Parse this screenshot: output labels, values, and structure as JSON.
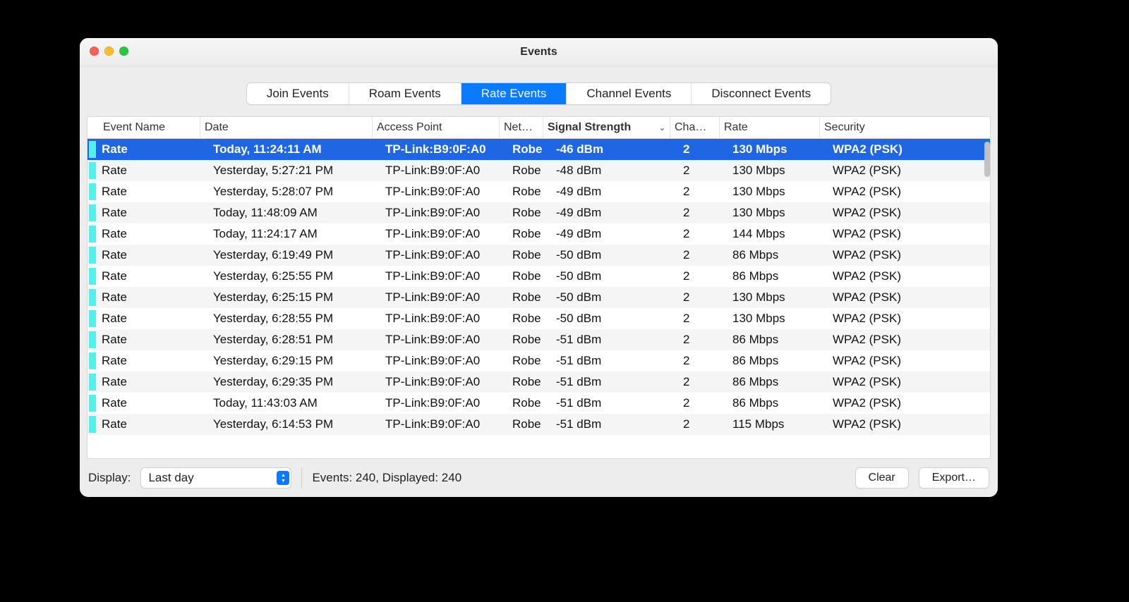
{
  "window": {
    "title": "Events"
  },
  "tabs": {
    "items": [
      "Join Events",
      "Roam Events",
      "Rate Events",
      "Channel Events",
      "Disconnect Events"
    ],
    "active_index": 2
  },
  "columns": {
    "event_name": "Event Name",
    "date": "Date",
    "access_point": "Access Point",
    "network": "Net…",
    "signal_strength": "Signal Strength",
    "channel": "Cha…",
    "rate": "Rate",
    "security": "Security",
    "sort_column": "signal_strength",
    "sort_dir_glyph": "⌄"
  },
  "rows": [
    {
      "event": "Rate",
      "date": "Today, 11:24:11 AM",
      "ap": "TP-Link:B9:0F:A0",
      "net": "Robe",
      "sig": "-46 dBm",
      "ch": "2",
      "rate": "130 Mbps",
      "sec": "WPA2 (PSK)",
      "selected": true
    },
    {
      "event": "Rate",
      "date": "Yesterday, 5:27:21 PM",
      "ap": "TP-Link:B9:0F:A0",
      "net": "Robe",
      "sig": "-48 dBm",
      "ch": "2",
      "rate": "130 Mbps",
      "sec": "WPA2 (PSK)"
    },
    {
      "event": "Rate",
      "date": "Yesterday, 5:28:07 PM",
      "ap": "TP-Link:B9:0F:A0",
      "net": "Robe",
      "sig": "-49 dBm",
      "ch": "2",
      "rate": "130 Mbps",
      "sec": "WPA2 (PSK)"
    },
    {
      "event": "Rate",
      "date": "Today, 11:48:09 AM",
      "ap": "TP-Link:B9:0F:A0",
      "net": "Robe",
      "sig": "-49 dBm",
      "ch": "2",
      "rate": "130 Mbps",
      "sec": "WPA2 (PSK)"
    },
    {
      "event": "Rate",
      "date": "Today, 11:24:17 AM",
      "ap": "TP-Link:B9:0F:A0",
      "net": "Robe",
      "sig": "-49 dBm",
      "ch": "2",
      "rate": "144 Mbps",
      "sec": "WPA2 (PSK)"
    },
    {
      "event": "Rate",
      "date": "Yesterday, 6:19:49 PM",
      "ap": "TP-Link:B9:0F:A0",
      "net": "Robe",
      "sig": "-50 dBm",
      "ch": "2",
      "rate": "86 Mbps",
      "sec": "WPA2 (PSK)"
    },
    {
      "event": "Rate",
      "date": "Yesterday, 6:25:55 PM",
      "ap": "TP-Link:B9:0F:A0",
      "net": "Robe",
      "sig": "-50 dBm",
      "ch": "2",
      "rate": "86 Mbps",
      "sec": "WPA2 (PSK)"
    },
    {
      "event": "Rate",
      "date": "Yesterday, 6:25:15 PM",
      "ap": "TP-Link:B9:0F:A0",
      "net": "Robe",
      "sig": "-50 dBm",
      "ch": "2",
      "rate": "130 Mbps",
      "sec": "WPA2 (PSK)"
    },
    {
      "event": "Rate",
      "date": "Yesterday, 6:28:55 PM",
      "ap": "TP-Link:B9:0F:A0",
      "net": "Robe",
      "sig": "-50 dBm",
      "ch": "2",
      "rate": "130 Mbps",
      "sec": "WPA2 (PSK)"
    },
    {
      "event": "Rate",
      "date": "Yesterday, 6:28:51 PM",
      "ap": "TP-Link:B9:0F:A0",
      "net": "Robe",
      "sig": "-51 dBm",
      "ch": "2",
      "rate": "86 Mbps",
      "sec": "WPA2 (PSK)"
    },
    {
      "event": "Rate",
      "date": "Yesterday, 6:29:15 PM",
      "ap": "TP-Link:B9:0F:A0",
      "net": "Robe",
      "sig": "-51 dBm",
      "ch": "2",
      "rate": "86 Mbps",
      "sec": "WPA2 (PSK)"
    },
    {
      "event": "Rate",
      "date": "Yesterday, 6:29:35 PM",
      "ap": "TP-Link:B9:0F:A0",
      "net": "Robe",
      "sig": "-51 dBm",
      "ch": "2",
      "rate": "86 Mbps",
      "sec": "WPA2 (PSK)"
    },
    {
      "event": "Rate",
      "date": "Today, 11:43:03 AM",
      "ap": "TP-Link:B9:0F:A0",
      "net": "Robe",
      "sig": "-51 dBm",
      "ch": "2",
      "rate": "86 Mbps",
      "sec": "WPA2 (PSK)"
    },
    {
      "event": "Rate",
      "date": "Yesterday, 6:14:53 PM",
      "ap": "TP-Link:B9:0F:A0",
      "net": "Robe",
      "sig": "-51 dBm",
      "ch": "2",
      "rate": "115 Mbps",
      "sec": "WPA2 (PSK)"
    }
  ],
  "footer": {
    "display_label": "Display:",
    "display_value": "Last day",
    "status": "Events: 240, Displayed: 240",
    "clear_label": "Clear",
    "export_label": "Export…"
  }
}
